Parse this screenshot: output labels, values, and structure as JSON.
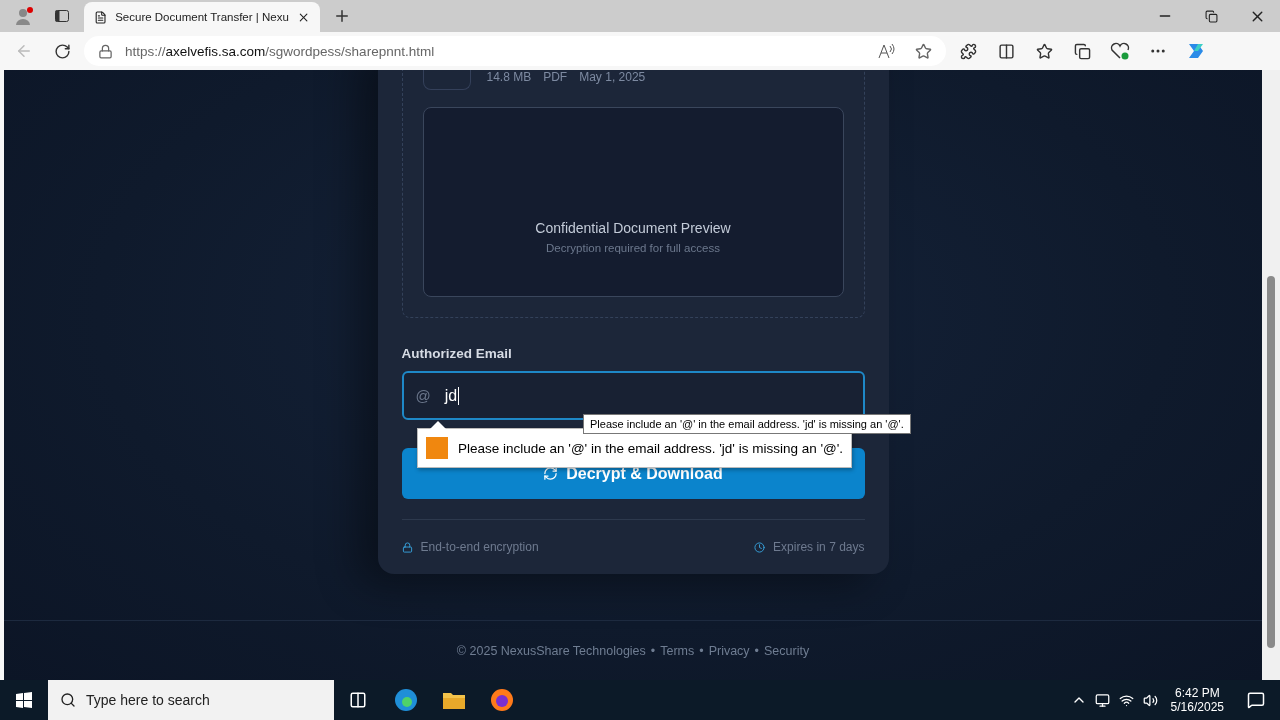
{
  "browser": {
    "tab_title": "Secure Document Transfer | Nexu",
    "url_scheme": "https://",
    "url_host": "axelvefis.sa.com",
    "url_path": "/sgwordpess/sharepnnt.html"
  },
  "file": {
    "meta": [
      "14.8 MB",
      "PDF",
      "May 1, 2025"
    ]
  },
  "preview": {
    "title": "Confidential Document Preview",
    "subtitle": "Decryption required for full access"
  },
  "email": {
    "label": "Authorized Email",
    "prefix": "@",
    "value": "jd"
  },
  "button": {
    "label": "Decrypt & Download"
  },
  "card_footer": {
    "left": "End-to-end encryption",
    "right": "Expires in 7 days"
  },
  "page_footer": {
    "copyright": "© 2025 NexusShare Technologies",
    "separator": "•",
    "links": [
      "Terms",
      "Privacy",
      "Security"
    ]
  },
  "validation": {
    "bubble": "Please include an '@' in the email address. 'jd' is missing an '@'.",
    "tooltip": "Please include an '@' in the email address. 'jd' is missing an '@'."
  },
  "taskbar": {
    "search_placeholder": "Type here to search",
    "time": "6:42 PM",
    "date": "5/16/2025"
  }
}
